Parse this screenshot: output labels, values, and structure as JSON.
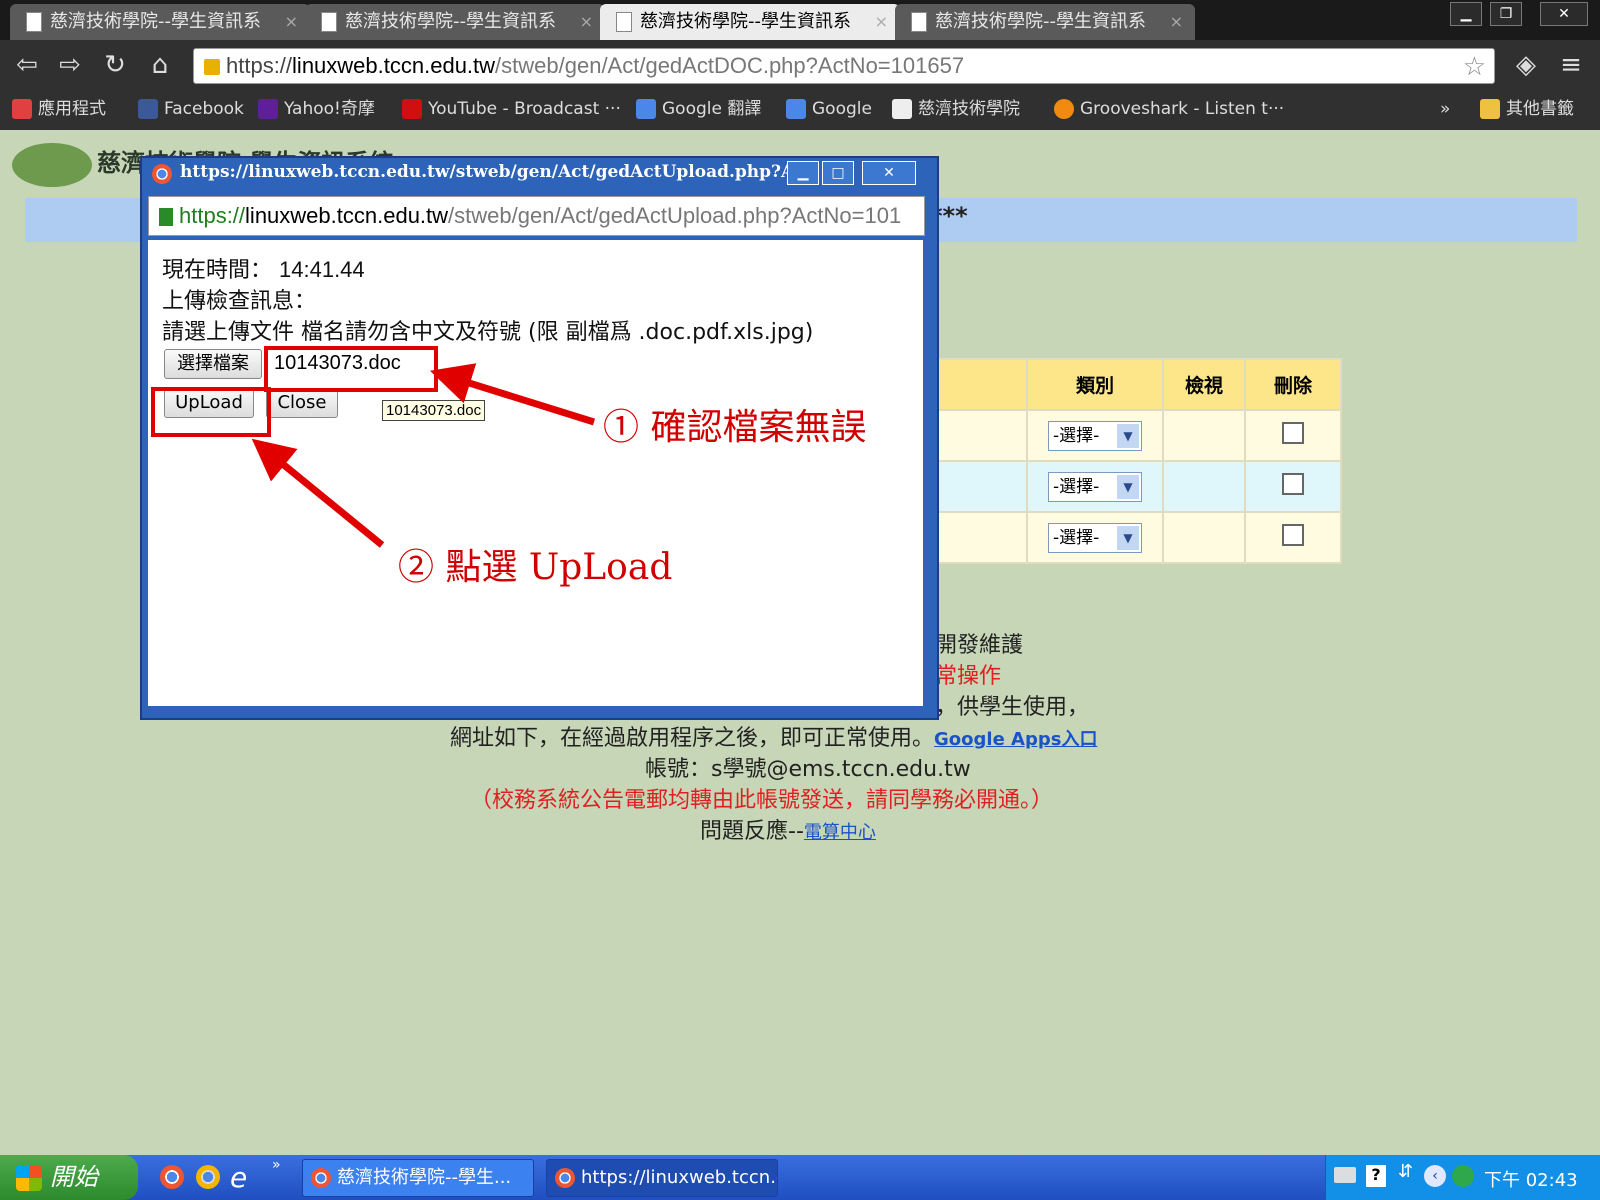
{
  "browser": {
    "tabs": [
      {
        "title": "慈濟技術學院--學生資訊系"
      },
      {
        "title": "慈濟技術學院--學生資訊系"
      },
      {
        "title": "慈濟技術學院--學生資訊系"
      },
      {
        "title": "慈濟技術學院--學生資訊系"
      }
    ],
    "close_glyph": "×",
    "url_scheme": "https://",
    "url_host": "linuxweb.tccn.edu.tw",
    "url_path": "/stweb/gen/Act/gedActDOC.php?ActNo=101657",
    "bookmarks": [
      {
        "label": "應用程式",
        "icon": "apps-icon",
        "color": "#e04040"
      },
      {
        "label": "Facebook",
        "icon": "facebook-icon",
        "color": "#3b5998"
      },
      {
        "label": "Yahoo!奇摩",
        "icon": "yahoo-icon",
        "color": "#5f1f9a"
      },
      {
        "label": "YouTube - Broadcast ···",
        "icon": "youtube-icon",
        "color": "#d01010"
      },
      {
        "label": "Google 翻譯",
        "icon": "translate-icon",
        "color": "#4a87e8"
      },
      {
        "label": "Google",
        "icon": "google-icon",
        "color": "#4a87e8"
      },
      {
        "label": "慈濟技術學院",
        "icon": "page-icon",
        "color": "#eeeeee"
      },
      {
        "label": "Grooveshark - Listen t···",
        "icon": "grooveshark-icon",
        "color": "#f08a10"
      }
    ],
    "bookmarks_more": "»",
    "other_bookmarks": "其他書籤"
  },
  "page": {
    "school_title": "慈濟技術學院 學生資訊系統",
    "banner_suffix": "*** ",
    "table": {
      "headers": [
        "類別",
        "檢視",
        "刪除"
      ],
      "rows": [
        {
          "select": "-選擇-"
        },
        {
          "select": "-選擇-"
        },
        {
          "select": "-選擇-"
        }
      ]
    },
    "footer": {
      "line1": "開發維護",
      "line2": "常操作",
      "line3": "，供學生使用，",
      "line4": "網址如下，在經過啟用程序之後，即可正常使用。",
      "google_apps_link": "Google Apps入口",
      "line5": "帳號：s學號@ems.tccn.edu.tw",
      "line6": "（校務系統公告電郵均轉由此帳號發送，請同學務必開通。）",
      "line7_prefix": "問題反應--",
      "line7_link": "電算中心"
    }
  },
  "popup": {
    "title": "https://linuxweb.tccn.edu.tw/stweb/gen/Act/gedActUpload.php?A···",
    "url_scheme": "https://",
    "url_host": "linuxweb.tccn.edu.tw",
    "url_path": "/stweb/gen/Act/gedActUpload.php?ActNo=101",
    "time_label": "現在時間：",
    "time_value": "14:41.44",
    "upload_msg_label": "上傳檢查訊息：",
    "instruction": "請選上傳文件 檔名請勿含中文及符號 (限 副檔爲 .doc.pdf.xls.jpg)",
    "choose_file_button": "選擇檔案",
    "file_name": "10143073.doc",
    "upload_button": "UpLoad",
    "close_button": "Close",
    "tooltip": "10143073.doc"
  },
  "annotations": {
    "step1": "① 確認檔案無誤",
    "step2": "② 點選 UpLoad",
    "color": "#e00000"
  },
  "taskbar": {
    "start_label": "開始",
    "tasks": [
      {
        "label": "慈濟技術學院--學生..."
      },
      {
        "label": "https://linuxweb.tccn.e..."
      }
    ],
    "clock": "下午 02:43",
    "more": "»"
  }
}
